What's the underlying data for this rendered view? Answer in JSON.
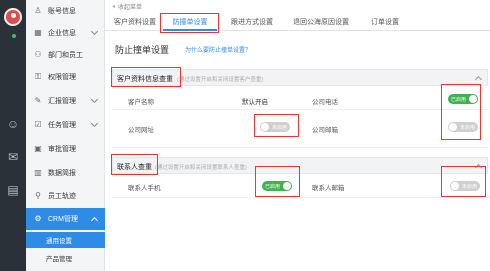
{
  "sidebar": {
    "items": [
      {
        "label": "账号信息",
        "icon": "user-icon"
      },
      {
        "label": "企业信息",
        "icon": "building-icon"
      },
      {
        "label": "部门和员工",
        "icon": "org-icon"
      },
      {
        "label": "权限管理",
        "icon": "lock-icon"
      },
      {
        "label": "汇报管理",
        "icon": "report-icon"
      },
      {
        "label": "任务管理",
        "icon": "task-icon"
      },
      {
        "label": "审批管理",
        "icon": "approval-icon"
      },
      {
        "label": "数据简报",
        "icon": "chart-icon"
      },
      {
        "label": "员工轨迹",
        "icon": "location-icon"
      },
      {
        "label": "CRM管理",
        "icon": "crm-icon"
      }
    ],
    "sub_items": [
      {
        "label": "通用设置"
      },
      {
        "label": "产品管理"
      }
    ]
  },
  "breadcrumb": {
    "label": "收起菜单"
  },
  "tabs": [
    {
      "label": "客户资料设置"
    },
    {
      "label": "防撞单设置"
    },
    {
      "label": "跟进方式设置"
    },
    {
      "label": "退回公海原因设置"
    },
    {
      "label": "订单设置"
    }
  ],
  "page": {
    "title": "防止撞单设置",
    "help_link": "为什么要防止撞单设置？"
  },
  "section_customer": {
    "title": "客户资料信息查重",
    "note": "(通过设置开启和关闭设置客户查重)",
    "rows": [
      {
        "left_label": "客户名称",
        "left_value": "默认开启",
        "right_label": "公司电话",
        "right_state": "已启用"
      },
      {
        "left_label": "公司网址",
        "left_state": "未启用",
        "right_label": "公司邮箱",
        "right_state": "未启用"
      }
    ]
  },
  "section_contact": {
    "title": "联系人查重",
    "note": "(通过设置开启和关闭设置联系人查重)",
    "rows": [
      {
        "left_label": "联系人手机",
        "left_state": "已启用",
        "right_label": "联系人邮箱",
        "right_state": "未启用"
      }
    ]
  },
  "colors": {
    "accent": "#2f8ce6",
    "on": "#3fb34f",
    "highlight": "#e33333"
  }
}
